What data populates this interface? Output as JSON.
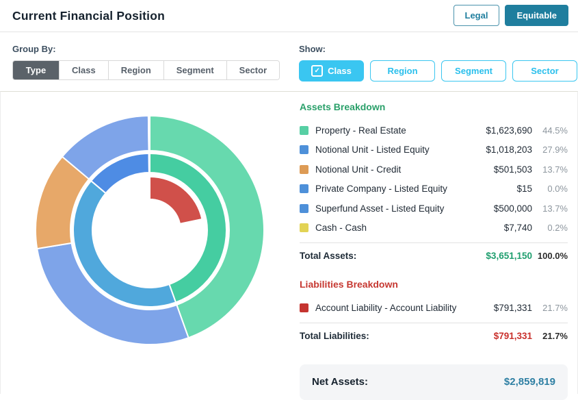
{
  "header": {
    "title": "Current Financial Position",
    "buttons": [
      {
        "label": "Legal",
        "active": false
      },
      {
        "label": "Equitable",
        "active": true
      }
    ]
  },
  "controls": {
    "group_by": {
      "label": "Group By:",
      "options": [
        "Type",
        "Class",
        "Region",
        "Segment",
        "Sector"
      ],
      "selected": "Type"
    },
    "show": {
      "label": "Show:",
      "options": [
        {
          "label": "Class",
          "checked": true
        },
        {
          "label": "Region",
          "checked": false
        },
        {
          "label": "Segment",
          "checked": false
        },
        {
          "label": "Sector",
          "checked": false
        }
      ]
    }
  },
  "assets": {
    "heading": "Assets Breakdown",
    "items": [
      {
        "label": "Property - Real Estate",
        "value": "$1,623,690",
        "pct": "44.5%",
        "color": "#57cfa4"
      },
      {
        "label": "Notional Unit - Listed Equity",
        "value": "$1,018,203",
        "pct": "27.9%",
        "color": "#4e90d9"
      },
      {
        "label": "Notional Unit - Credit",
        "value": "$501,503",
        "pct": "13.7%",
        "color": "#dd9b55"
      },
      {
        "label": "Private Company - Listed Equity",
        "value": "$15",
        "pct": "0.0%",
        "color": "#4e90d9"
      },
      {
        "label": "Superfund Asset - Listed Equity",
        "value": "$500,000",
        "pct": "13.7%",
        "color": "#4e90d9"
      },
      {
        "label": "Cash - Cash",
        "value": "$7,740",
        "pct": "0.2%",
        "color": "#e2d355"
      }
    ],
    "total": {
      "label": "Total Assets:",
      "value": "$3,651,150",
      "pct": "100.0%"
    }
  },
  "liabilities": {
    "heading": "Liabilities Breakdown",
    "items": [
      {
        "label": "Account Liability - Account Liability",
        "value": "$791,331",
        "pct": "21.7%",
        "color": "#c53430"
      }
    ],
    "total": {
      "label": "Total Liabilities:",
      "value": "$791,331",
      "pct": "21.7%"
    }
  },
  "net_assets": {
    "label": "Net Assets:",
    "value": "$2,859,819"
  },
  "colors": {
    "accent_teal": "#1f7e9e",
    "show_cyan": "#3ac6f1",
    "assets_green": "#2aa06a",
    "liabilities_red": "#c63831",
    "net_value_teal": "#2e7fa3",
    "groupby_selected_bg": "#5b6269"
  },
  "chart_data": {
    "type": "pie",
    "subtype": "multi-ring-donut",
    "units": "percent-of-total-assets",
    "start_angle_deg": 0,
    "direction": "clockwise",
    "legend_position": "right-list",
    "rings": [
      {
        "name": "assets-by-item-outer",
        "outer_radius": 167,
        "inner_radius": 116,
        "segments": [
          {
            "label": "Property - Real Estate",
            "value": 44.5,
            "amount": 1623690,
            "color": "#67d9ae"
          },
          {
            "label": "Notional Unit - Listed Equity",
            "value": 27.9,
            "amount": 1018203,
            "color": "#7ea4e9"
          },
          {
            "label": "Notional Unit - Credit",
            "value": 13.7,
            "amount": 501503,
            "color": "#e7a869"
          },
          {
            "label": "Private Company - Listed Equity",
            "value": 0.0,
            "amount": 15,
            "color": "#5b93dd"
          },
          {
            "label": "Superfund Asset - Listed Equity",
            "value": 13.7,
            "amount": 500000,
            "color": "#7ea4e9"
          },
          {
            "label": "Cash - Cash",
            "value": 0.2,
            "amount": 7740,
            "color": "#e8df66"
          }
        ]
      },
      {
        "name": "assets-by-type-middle",
        "outer_radius": 112,
        "inner_radius": 84,
        "segments": [
          {
            "label": "Property",
            "value": 44.5,
            "amount": 1623690,
            "color": "#45cda1"
          },
          {
            "label": "Notional Unit",
            "value": 41.6,
            "amount": 1519706,
            "color": "#50a8dc"
          },
          {
            "label": "Private Company",
            "value": 0.0,
            "amount": 15,
            "color": "#5b93dd"
          },
          {
            "label": "Superfund Asset",
            "value": 13.7,
            "amount": 500000,
            "color": "#4e8ce4"
          },
          {
            "label": "Cash",
            "value": 0.2,
            "amount": 7740,
            "color": "#e8df66"
          }
        ]
      },
      {
        "name": "liabilities-inner",
        "outer_radius": 78,
        "inner_radius": 45,
        "segments": [
          {
            "label": "Account Liability - Account Liability",
            "value": 21.7,
            "amount": 791331,
            "color": "#d0504a"
          },
          {
            "label": "",
            "value": 78.3,
            "color": "none"
          }
        ]
      }
    ]
  }
}
